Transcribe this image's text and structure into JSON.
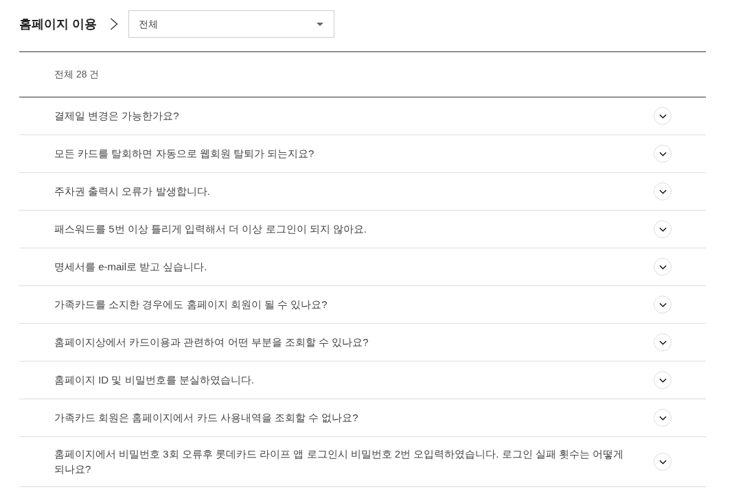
{
  "breadcrumb": {
    "title": "홈페이지 이용"
  },
  "category_select": {
    "value": "전체"
  },
  "total_count": "전체 28 건",
  "faq_items": [
    {
      "question": "결제일 변경은 가능한가요?",
      "expanded": false
    },
    {
      "question": "모든 카드를 탈회하면 자동으로 웹회원 탈퇴가 되는지요?",
      "expanded": false
    },
    {
      "question": "주차권 출력시 오류가 발생합니다.",
      "expanded": false
    },
    {
      "question": "패스워드를 5번 이상 틀리게 입력해서 더 이상 로그인이 되지 않아요.",
      "expanded": false
    },
    {
      "question": "명세서를 e-mail로 받고 싶습니다.",
      "expanded": false
    },
    {
      "question": "가족카드를 소지한 경우에도 홈페이지 회원이 될 수 있나요?",
      "expanded": false
    },
    {
      "question": "홈페이지상에서 카드이용과 관련하여 어떤 부분을 조회할 수 있나요?",
      "expanded": false
    },
    {
      "question": "홈페이지 ID 및 비밀번호를 분실하였습니다.",
      "expanded": false
    },
    {
      "question": "가족카드 회원은 홈페이지에서 카드 사용내역을 조회할 수 없나요?",
      "expanded": false
    },
    {
      "question": "홈페이지에서 비밀번호 3회 오류후 롯데카드 라이프 앱 로그인시 비밀번호 2번 오입력하였습니다. 로그인 실패 횟수는 어떻게 되나요?",
      "expanded": false
    }
  ]
}
